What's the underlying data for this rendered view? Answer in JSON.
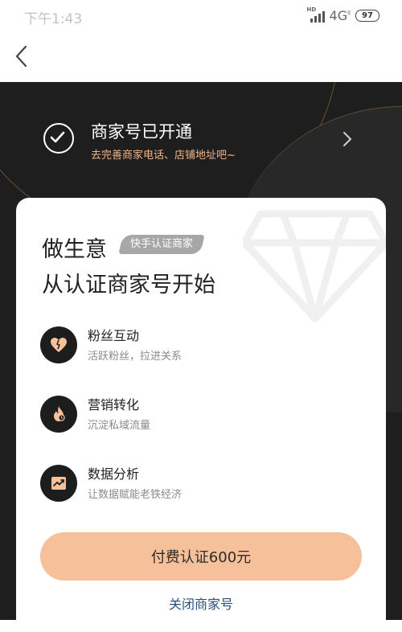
{
  "status_bar": {
    "time": "下午1:43",
    "hd_label": "HD",
    "network": "4G",
    "network_sup": "ll",
    "battery": "97"
  },
  "nav": {
    "back_icon": "chevron-left-icon"
  },
  "banner": {
    "title": "商家号已开通",
    "subtitle": "去完善商家电话、店铺地址吧~",
    "status_icon": "check-circle-icon",
    "chevron_icon": "chevron-right-icon"
  },
  "card": {
    "headline_line1": "做生意",
    "tag": "快手认证商家",
    "headline_line2": "从认证商家号开始",
    "features": [
      {
        "title": "粉丝互动",
        "desc": "活跃粉丝，拉进关系",
        "icon": "heart-icon"
      },
      {
        "title": "营销转化",
        "desc": "沉淀私域流量",
        "icon": "flame-icon"
      },
      {
        "title": "数据分析",
        "desc": "让数据赋能老铁经济",
        "icon": "trend-chart-icon"
      }
    ],
    "pay_button": "付费认证600元",
    "close_link": "关闭商家号"
  },
  "colors": {
    "dark_bg": "#1e1e1e",
    "accent_orange": "#f0b48a",
    "button_bg": "#f5c09a",
    "link_blue": "#2a4f7a"
  }
}
